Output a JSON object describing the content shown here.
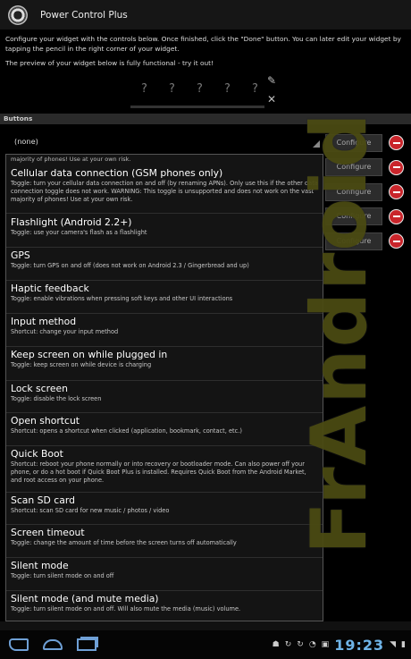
{
  "app": {
    "title": "Power Control Plus"
  },
  "intro": {
    "text": "Configure your widget with the controls below. Once finished, click the \"Done\" button. You can later edit your widget by tapping the pencil in the right corner of your widget.",
    "preview_text": "The preview of your widget below is fully functional - try it out!"
  },
  "preview": {
    "cells": [
      "?",
      "?",
      "?",
      "?",
      "?"
    ]
  },
  "buttons_section": {
    "label": "Buttons",
    "selected": "(none)",
    "configure_label": "Configure",
    "rows": 5
  },
  "popup": {
    "top_snippet": "majority of phones! Use at your own risk.",
    "items": [
      {
        "title": "Cellular data connection (GSM phones only)",
        "desc": "Toggle: turn your cellular data connection on and off (by renaming APNs). Only use this if the other data connection toggle does not work. WARNING: This toggle is unsupported and does not work on the vast majority of phones! Use at your own risk."
      },
      {
        "title": "Flashlight (Android 2.2+)",
        "desc": "Toggle: use your camera's flash as a flashlight"
      },
      {
        "title": "GPS",
        "desc": "Toggle: turn GPS on and off (does not work on Android 2.3 / Gingerbread and up)"
      },
      {
        "title": "Haptic feedback",
        "desc": "Toggle: enable vibrations when pressing soft keys and other UI interactions"
      },
      {
        "title": "Input method",
        "desc": "Shortcut: change your input method"
      },
      {
        "title": "Keep screen on while plugged in",
        "desc": "Toggle: keep screen on while device is charging"
      },
      {
        "title": "Lock screen",
        "desc": "Toggle: disable the lock screen"
      },
      {
        "title": "Open shortcut",
        "desc": "Shortcut: opens a shortcut when clicked (application, bookmark, contact, etc.)"
      },
      {
        "title": "Quick Boot",
        "desc": "Shortcut: reboot your phone normally or into recovery or bootloader mode. Can also power off your phone, or do a hot boot if Quick Boot Plus is installed. Requires Quick Boot from the Android Market, and root access on your phone."
      },
      {
        "title": "Scan SD card",
        "desc": "Shortcut: scan SD card for new music / photos / video"
      },
      {
        "title": "Screen timeout",
        "desc": "Toggle: change the amount of time before the screen turns off automatically"
      },
      {
        "title": "Silent mode",
        "desc": "Toggle: turn silent mode on and off"
      },
      {
        "title": "Silent mode (and mute media)",
        "desc": "Toggle: turn silent mode on and off. Will also mute the media (music) volume."
      }
    ]
  },
  "watermark": {
    "text": "FrAndroid"
  },
  "statusbar": {
    "time": "19:23"
  },
  "colors": {
    "accent": "#6fb4e8",
    "watermark": "#4a4a12",
    "remove": "#c9252b"
  }
}
